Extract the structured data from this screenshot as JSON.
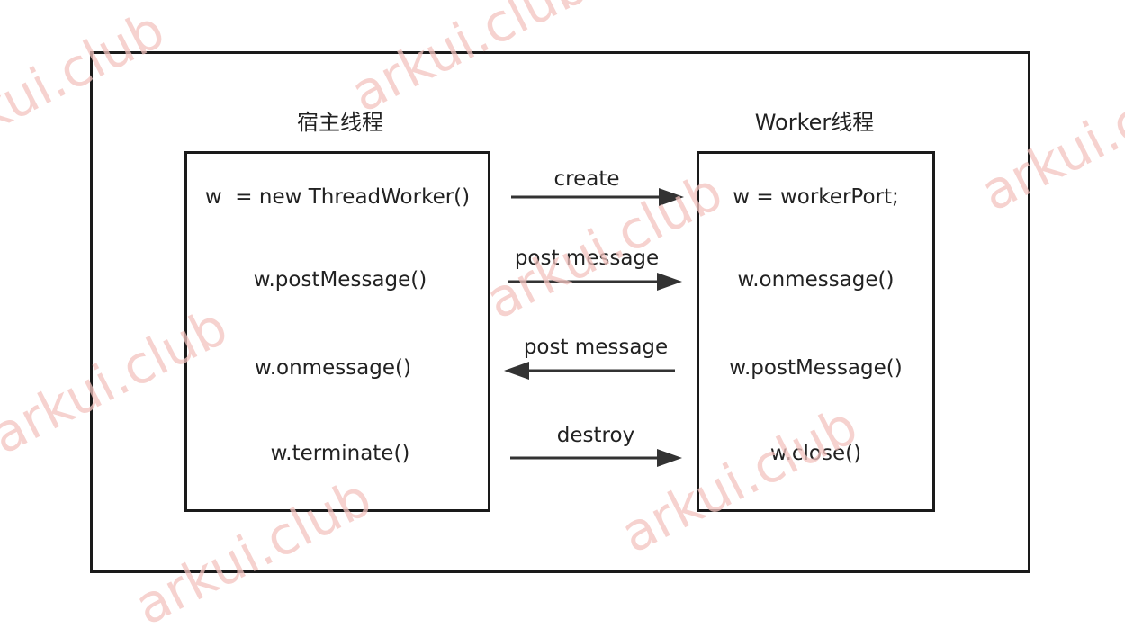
{
  "host": {
    "title": "宿主线程",
    "statements": [
      "w  = new ThreadWorker()",
      "w.postMessage()",
      "w.onmessage()",
      "w.terminate()"
    ]
  },
  "worker": {
    "title": "Worker线程",
    "statements": [
      "w = workerPort;",
      "w.onmessage()",
      "w.postMessage()",
      "w.close()"
    ]
  },
  "arrows": [
    {
      "label": "create",
      "direction": "right"
    },
    {
      "label": "post message",
      "direction": "right"
    },
    {
      "label": "post message",
      "direction": "left"
    },
    {
      "label": "destroy",
      "direction": "right"
    }
  ],
  "watermark": "arkui.club",
  "colors": {
    "stroke": "#1a1a1a",
    "arrow": "#333333",
    "watermark": "#f3c3bf"
  }
}
